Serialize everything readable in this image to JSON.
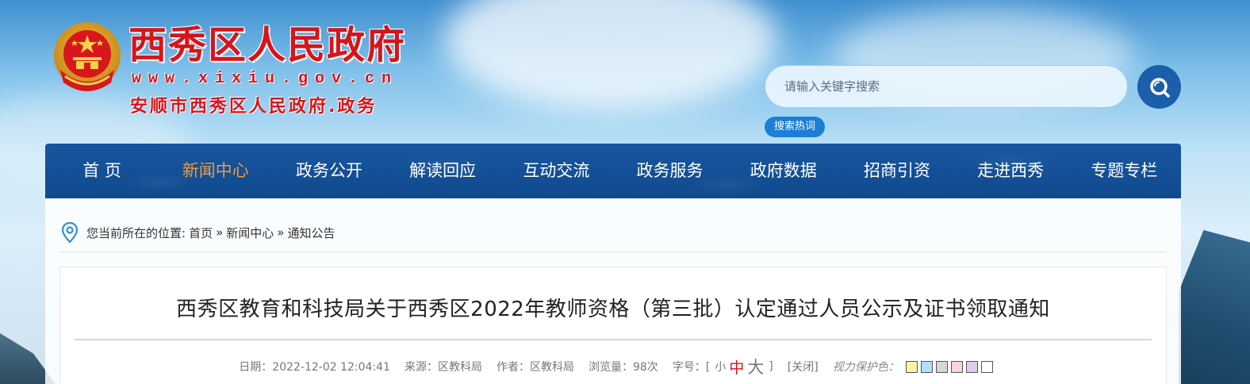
{
  "site": {
    "title": "西秀区人民政府",
    "url": "www.xixiu.gov.cn",
    "subtitle": "安顺市西秀区人民政府.政务"
  },
  "search": {
    "placeholder": "请输入关键字搜索",
    "hot_words_label": "搜索热词",
    "icon": "search-icon"
  },
  "nav": {
    "items": [
      {
        "label": "首 页",
        "active": false
      },
      {
        "label": "新闻中心",
        "active": true
      },
      {
        "label": "政务公开",
        "active": false
      },
      {
        "label": "解读回应",
        "active": false
      },
      {
        "label": "互动交流",
        "active": false
      },
      {
        "label": "政务服务",
        "active": false
      },
      {
        "label": "政府数据",
        "active": false
      },
      {
        "label": "招商引资",
        "active": false
      },
      {
        "label": "走进西秀",
        "active": false
      },
      {
        "label": "专题专栏",
        "active": false
      }
    ],
    "active_color": "#f29a3a",
    "bg_color": "#17569f"
  },
  "breadcrumb": {
    "prefix": "您当前所在的位置:",
    "items": [
      "首页",
      "新闻中心",
      "通知公告"
    ],
    "separator": "»",
    "icon": "location-pin-icon"
  },
  "article": {
    "title": "西秀区教育和科技局关于西秀区2022年教师资格（第三批）认定通过人员公示及证书领取通知",
    "meta": {
      "date": "日期：2022-12-02 12:04:41",
      "source": "来源：区教科局",
      "author": "作者：区教科局",
      "views": "浏览量：98次",
      "font_size_label": "字号：[",
      "font_small": "小",
      "font_mid": "中",
      "font_big": "大",
      "font_close_bracket": "]",
      "close": "[关闭]",
      "eye_protect_label": "视力保护色："
    },
    "eye_colors": [
      "#fbf3a6",
      "#b3dff7",
      "#d6d6d6",
      "#f8d2dc",
      "#e2c9f2",
      "#ffffff"
    ]
  },
  "colors": {
    "brand_red": "#d7141a",
    "nav_blue": "#17569f",
    "search_button": "#1b5eab"
  }
}
